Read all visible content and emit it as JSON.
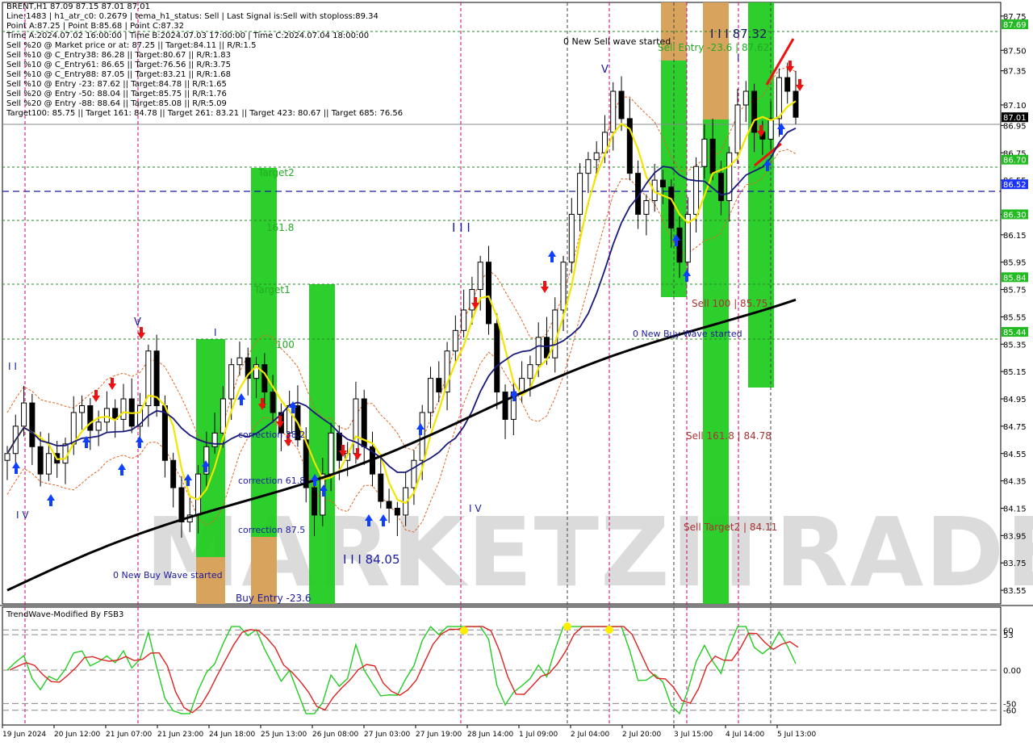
{
  "header": {
    "lines": [
      "BRENT,H1  87.09 87.15 87.01 87.01",
      "Line:1483 | h1_atr_c0: 0.2679 | tema_h1_status: Sell | Last Signal is:Sell with stoploss:89.34",
      "Point A:87.25 | Point B:85.68 | Point C:87.32",
      "Time A:2024.07.02 16:00:00 | Time B:2024.07.03 17:00:00 | Time C:2024.07.04 18:00:00",
      "Sell %20 @ Market price or at: 87.25 || Target:84.11 || R/R:1.5",
      "Sell %10 @ C_Entry38: 86.28 || Target:80.67 || R/R:1.83",
      "Sell %10 @ C_Entry61: 86.65 || Target:76.56 || R/R:3.75",
      "Sell %10 @ C_Entry88: 87.05 || Target:83.21 || R/R:1.68",
      "Sell %10 @ Entry -23: 87.62 || Target:84.78 || R/R:1.65",
      "Sell %20 @ Entry -50: 88.04 || Target:85.75 || R/R:1.76",
      "Sell %20 @ Entry -88: 88.64 || Target:85.08 || R/R:5.09",
      "Target100: 85.75 || Target 161: 84.78 || Target 261: 83.21 || Target 423: 80.67 || Target 685: 76.56"
    ]
  },
  "annotations": {
    "new_sell_wave": "0 New Sell wave started",
    "sell_entry": "Sell Entry -23.6 | 87.62",
    "peak_label": "I I I 87.32",
    "target2": "Target2",
    "fib_1618": "161.8",
    "target1": "Target1",
    "fib_100": "100",
    "iii_mid": "I I I",
    "sell_100": "Sell 100 | 85.75",
    "new_buy_wave_right": "0 New Buy Wave started",
    "sell_1618": "Sell 161.8 | 84.78",
    "sell_target2": "Sell Target2 | 84.11",
    "correction_382": "correction 38.2",
    "correction_618": "correction 61.8",
    "correction_875": "correction 87.5",
    "low_label": "I I I 84.05",
    "new_buy_wave_left": "0 New Buy Wave started",
    "buy_entry": "Buy Entry -23.6",
    "iv_left": "I V",
    "iv_mid": "I V",
    "ii_left": "I I",
    "v_mark_1": "V",
    "v_mark_2": "V",
    "i_mark_1": "I",
    "i_mark_2": "I",
    "watermark": "MARKETZITRADE"
  },
  "indicator": {
    "title": "TrendWave-Modified By FSB3",
    "levels": [
      "60",
      "53",
      "0.00",
      "-50",
      "-60"
    ]
  },
  "colors": {
    "background": "#ffffff",
    "candle": "#000000",
    "yellow_line": "#f2e600",
    "navy_ma": "#1a1a7a",
    "black_ma": "#000000",
    "green_zone": "#22cc22",
    "orange_zone": "#e0a060",
    "blue_arrow": "#1040ff",
    "red_arrow": "#ee1111",
    "label_red": "#aa3333",
    "label_green": "#22aa22",
    "label_blue": "#1a1aa0",
    "osc_green": "#22cc22",
    "osc_red": "#dd2222",
    "price_tag_green": "#22bb22",
    "price_tag_blue": "#1a33ff",
    "price_tag_black": "#000000"
  },
  "chart_data": {
    "type": "candlestick",
    "symbol": "BRENT",
    "timeframe": "H1",
    "ohlc_last": {
      "open": 87.09,
      "high": 87.15,
      "low": 87.01,
      "close": 87.01
    },
    "ylim": [
      83.45,
      87.85
    ],
    "y_ticks": [
      "87.75",
      "87.50",
      "87.35",
      "87.10",
      "86.95",
      "86.75",
      "86.55",
      "86.30",
      "86.15",
      "85.95",
      "85.75",
      "85.55",
      "85.35",
      "85.15",
      "84.95",
      "84.75",
      "84.55",
      "84.35",
      "84.15",
      "83.95",
      "83.75",
      "83.55"
    ],
    "x_ticks": [
      "19 Jun 2024",
      "20 Jun 12:00",
      "21 Jun 07:00",
      "21 Jun 23:00",
      "24 Jun 18:00",
      "25 Jun 13:00",
      "26 Jun 08:00",
      "27 Jun 03:00",
      "27 Jun 19:00",
      "28 Jun 14:00",
      "1 Jul 09:00",
      "2 Jul 04:00",
      "2 Jul 20:00",
      "3 Jul 15:00",
      "4 Jul 14:00",
      "5 Jul 13:00"
    ],
    "price_tags": [
      {
        "value": "87.69",
        "kind": "green"
      },
      {
        "value": "87.01",
        "kind": "black"
      },
      {
        "value": "86.70",
        "kind": "green"
      },
      {
        "value": "86.52",
        "kind": "blue"
      },
      {
        "value": "86.30",
        "kind": "green"
      },
      {
        "value": "85.84",
        "kind": "green"
      },
      {
        "value": "85.44",
        "kind": "green"
      }
    ],
    "closes": [
      84.55,
      84.75,
      84.92,
      84.6,
      84.4,
      84.55,
      84.48,
      84.62,
      84.85,
      84.9,
      84.72,
      84.78,
      84.88,
      84.8,
      84.95,
      84.75,
      84.9,
      85.3,
      84.9,
      84.5,
      84.3,
      84.05,
      84.1,
      84.4,
      84.6,
      84.7,
      84.95,
      85.2,
      85.25,
      85.1,
      85.2,
      85.0,
      84.85,
      84.7,
      84.9,
      84.65,
      84.3,
      84.1,
      84.4,
      84.7,
      84.5,
      84.55,
      84.95,
      84.6,
      84.4,
      84.2,
      84.15,
      84.1,
      84.3,
      84.5,
      84.85,
      85.1,
      85.0,
      85.3,
      85.45,
      85.6,
      85.75,
      85.95,
      85.5,
      85.0,
      84.8,
      85.0,
      85.1,
      85.2,
      85.4,
      85.25,
      85.6,
      85.95,
      86.3,
      86.6,
      86.7,
      86.75,
      86.9,
      87.2,
      87.0,
      86.6,
      86.3,
      86.4,
      86.55,
      86.5,
      86.2,
      85.95,
      86.3,
      86.65,
      86.85,
      86.6,
      86.4,
      86.75,
      87.1,
      87.2,
      86.9,
      86.85,
      87.0,
      87.3,
      87.2,
      87.01
    ]
  }
}
